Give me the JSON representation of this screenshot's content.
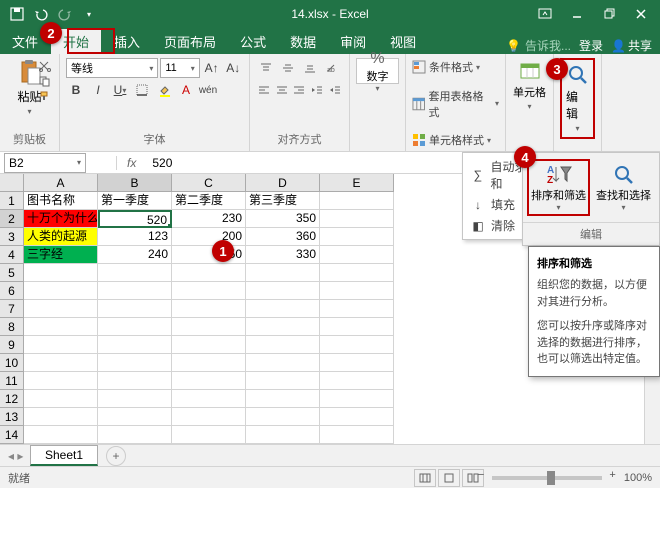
{
  "title": "14.xlsx - Excel",
  "qat": {
    "save": "💾",
    "undo": "↶",
    "redo": "↷"
  },
  "tabs": {
    "file": "文件",
    "home": "开始",
    "insert": "插入",
    "layout": "页面布局",
    "formula": "公式",
    "data": "数据",
    "review": "审阅",
    "view": "视图",
    "tellme": "告诉我...",
    "login": "登录",
    "share": "共享"
  },
  "ribbon": {
    "clipboard": {
      "paste": "粘贴",
      "label": "剪贴板"
    },
    "font": {
      "name": "等线",
      "size": "11",
      "label": "字体"
    },
    "align": {
      "label": "对齐方式"
    },
    "number": {
      "btn": "数字",
      "label": ""
    },
    "styles": {
      "cond": "条件格式",
      "table": "套用表格格式",
      "cell": "单元格样式",
      "label": ""
    },
    "cells": {
      "btn": "单元格",
      "label": ""
    },
    "edit": {
      "btn": "编辑",
      "label": ""
    }
  },
  "namebox": "B2",
  "formula_value": "520",
  "columns": [
    "A",
    "B",
    "C",
    "D",
    "E"
  ],
  "rows_shown": 14,
  "data_rows": [
    [
      "图书名称",
      "第一季度",
      "第二季度",
      "第三季度",
      ""
    ],
    [
      "十万个为什么",
      "520",
      "230",
      "350",
      ""
    ],
    [
      "人类的起源",
      "123",
      "200",
      "360",
      ""
    ],
    [
      "三字经",
      "240",
      "250",
      "330",
      ""
    ]
  ],
  "chart_data": {
    "type": "table",
    "columns": [
      "图书名称",
      "第一季度",
      "第二季度",
      "第三季度"
    ],
    "rows": [
      [
        "十万个为什么",
        520,
        230,
        350
      ],
      [
        "人类的起源",
        123,
        200,
        360
      ],
      [
        "三字经",
        240,
        250,
        330
      ]
    ]
  },
  "sheet_tab": "Sheet1",
  "status": "就绪",
  "zoom": "100%",
  "autosum_menu": {
    "sum": "自动求和",
    "fill": "填充",
    "clear": "清除"
  },
  "edit_panel": {
    "sort": "排序和筛选",
    "find": "查找和选择",
    "label": "编辑"
  },
  "tooltip": {
    "title": "排序和筛选",
    "p1": "组织您的数据，以方便对其进行分析。",
    "p2": "您可以按升序或降序对选择的数据进行排序，也可以筛选出特定值。"
  },
  "callouts": {
    "c1": "1",
    "c2": "2",
    "c3": "3",
    "c4": "4"
  }
}
